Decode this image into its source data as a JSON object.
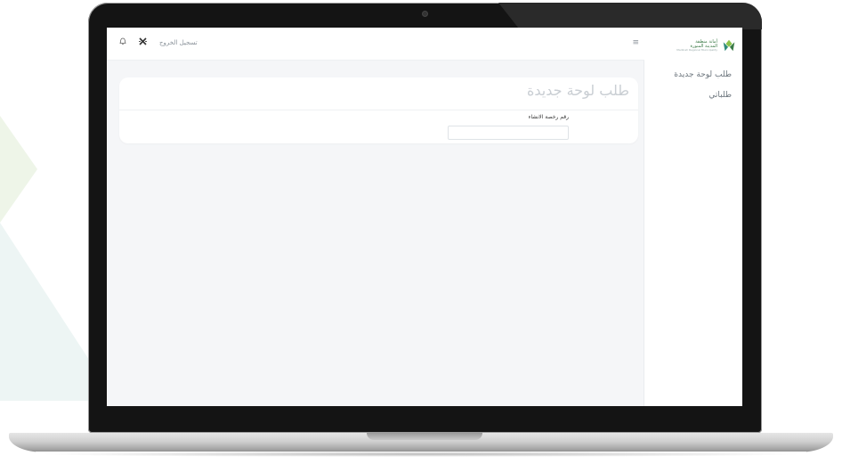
{
  "brand": {
    "name_line1": "أمانة منطقة",
    "name_line2": "المدينة المنورة",
    "name_line3": "Madinah Regional Municipality",
    "colors": {
      "green": "#3a7a46",
      "light_green": "#8bc34a",
      "teal": "#2e8b7a"
    }
  },
  "sidebar": {
    "items": [
      {
        "label": "طلب لوحة جديدة"
      },
      {
        "label": "طلباتي"
      }
    ]
  },
  "topbar": {
    "menu_icon": "hamburger-icon",
    "logout_label": "تسجيل الخروج",
    "icons": [
      "close-icon",
      "bell-icon"
    ]
  },
  "main": {
    "title": "طلب لوحة جديدة",
    "form": {
      "permit_label": "رقم رخصة الانشاء",
      "permit_value": "",
      "permit_placeholder": ""
    }
  }
}
